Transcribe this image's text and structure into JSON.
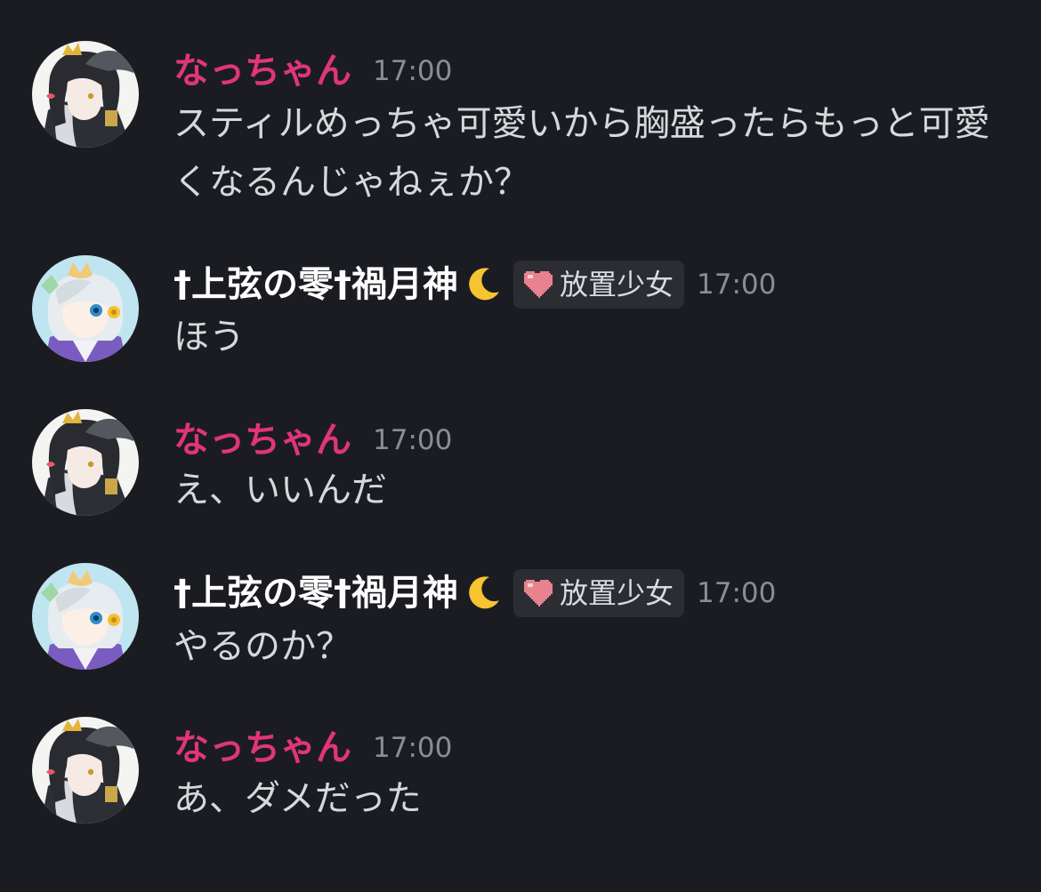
{
  "colors": {
    "background": "#1b1c21",
    "name_pink": "#e0357a",
    "name_white": "#ffffff",
    "text": "#d7d8dc",
    "timestamp": "#8b8d95",
    "tag_bg": "#2b2d33"
  },
  "messages": [
    {
      "author": "なっちゃん",
      "time": "17:00",
      "text": "スティルめっちゃ可愛いから胸盛ったらもっと可愛くなるんじゃねぇか？"
    },
    {
      "author": "†上弦の零†禍月神",
      "author_icon": "crescent-moon-icon",
      "tag_icon": "pixel-heart-icon",
      "tag": "放置少女",
      "time": "17:00",
      "text": "ほう"
    },
    {
      "author": "なっちゃん",
      "time": "17:00",
      "text": "え、いいんだ"
    },
    {
      "author": "†上弦の零†禍月神",
      "author_icon": "crescent-moon-icon",
      "tag_icon": "pixel-heart-icon",
      "tag": "放置少女",
      "time": "17:00",
      "text": "やるのか？"
    },
    {
      "author": "なっちゃん",
      "time": "17:00",
      "text": "あ、ダメだった"
    }
  ]
}
